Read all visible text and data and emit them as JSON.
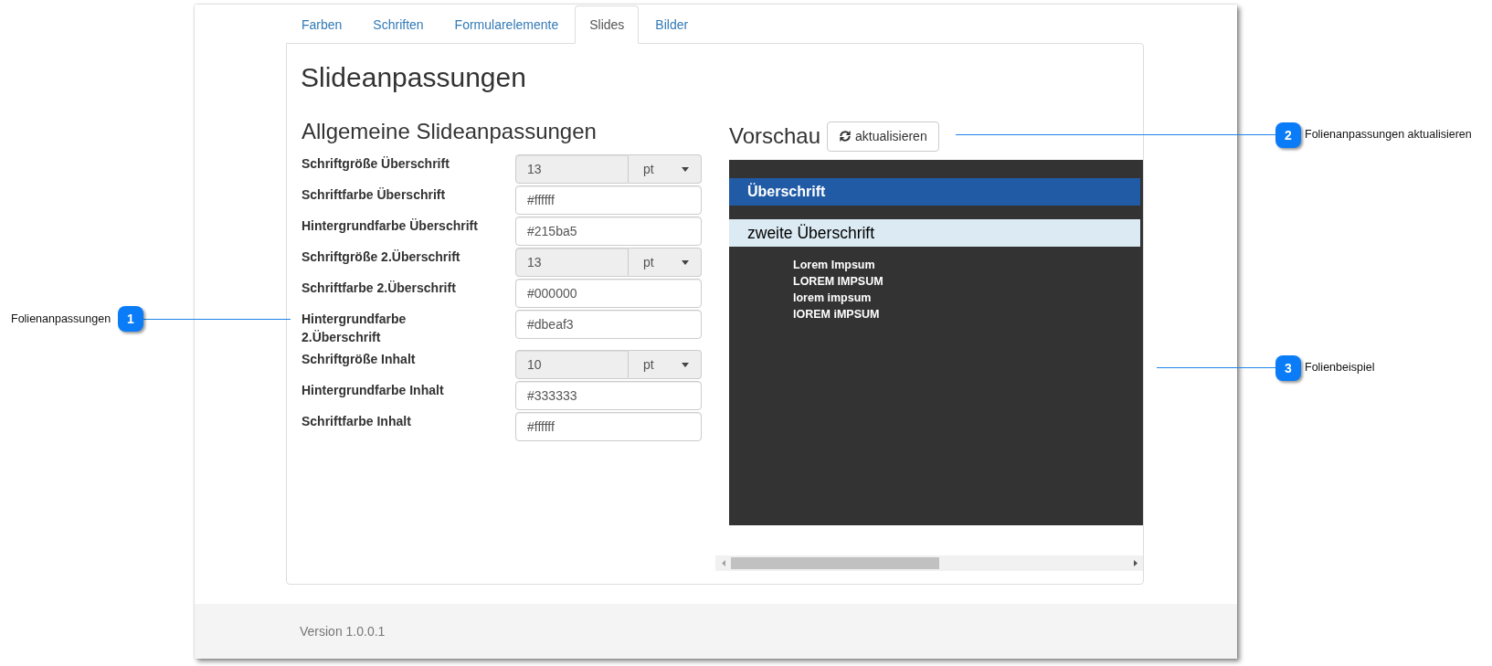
{
  "tabs": [
    {
      "label": "Farben",
      "selected": false
    },
    {
      "label": "Schriften",
      "selected": false
    },
    {
      "label": "Formularelemente",
      "selected": false
    },
    {
      "label": "Slides",
      "selected": true
    },
    {
      "label": "Bilder",
      "selected": false
    }
  ],
  "page_title": "Slideanpassungen",
  "settings": {
    "title": "Allgemeine Slideanpassungen",
    "fields": [
      {
        "kind": "size",
        "label": "Schriftgröße Überschrift",
        "value": "13",
        "unit": "pt",
        "disabled": true
      },
      {
        "kind": "color",
        "label": "Schriftfarbe Überschrift",
        "value": "#ffffff",
        "disabled": false
      },
      {
        "kind": "color",
        "label": "Hintergrundfarbe Überschrift",
        "value": "#215ba5",
        "disabled": false
      },
      {
        "kind": "size",
        "label": "Schriftgröße 2.Überschrift",
        "value": "13",
        "unit": "pt",
        "disabled": true
      },
      {
        "kind": "color",
        "label": "Schriftfarbe 2.Überschrift",
        "value": "#000000",
        "disabled": false
      },
      {
        "kind": "color",
        "label": "Hintergrundfarbe 2.Überschrift",
        "value": "#dbeaf3",
        "disabled": false
      },
      {
        "kind": "size",
        "label": "Schriftgröße Inhalt",
        "value": "10",
        "unit": "pt",
        "disabled": true
      },
      {
        "kind": "color",
        "label": "Hintergrundfarbe Inhalt",
        "value": "#333333",
        "disabled": false
      },
      {
        "kind": "color",
        "label": "Schriftfarbe Inhalt",
        "value": "#ffffff",
        "disabled": false
      }
    ]
  },
  "preview": {
    "title": "Vorschau",
    "refresh_button": "aktualisieren",
    "slide": {
      "heading": "Überschrift",
      "subheading": "zweite Überschrift",
      "content_lines": [
        "Lorem Impsum",
        "LOREM IMPSUM",
        "lorem impsum",
        "lOREM iMPSUM"
      ]
    }
  },
  "footer": {
    "version": "Version 1.0.0.1"
  },
  "callouts": [
    {
      "number": "1",
      "text": "Folienanpassungen"
    },
    {
      "number": "2",
      "text": "Folienanpassungen aktualisieren"
    },
    {
      "number": "3",
      "text": "Folienbeispiel"
    }
  ]
}
